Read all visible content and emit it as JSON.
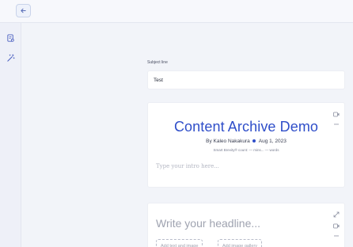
{
  "subject": {
    "label": "Subject line",
    "value": "Test"
  },
  "document": {
    "title": "Content Archive Demo",
    "author": "By Kaleo Nakakura",
    "date": "Aug 1, 2023",
    "stats": "Smart Brevity® count: — mins... — words",
    "intro_placeholder": "Type your intro here..."
  },
  "section": {
    "headline_placeholder": "Write your headline...",
    "add_text_button": "Add text and image",
    "add_image_button": "Add image gallery"
  },
  "icons": {
    "back": "arrow-left-icon",
    "sidebar_doc": "document-search-icon",
    "sidebar_magic": "magic-wand-icon",
    "card_video": "video-icon",
    "card_more": "more-vertical-icon",
    "card_expand": "expand-icon"
  },
  "colors": {
    "accent": "#2f4ec9",
    "background": "#f2f4f9"
  }
}
